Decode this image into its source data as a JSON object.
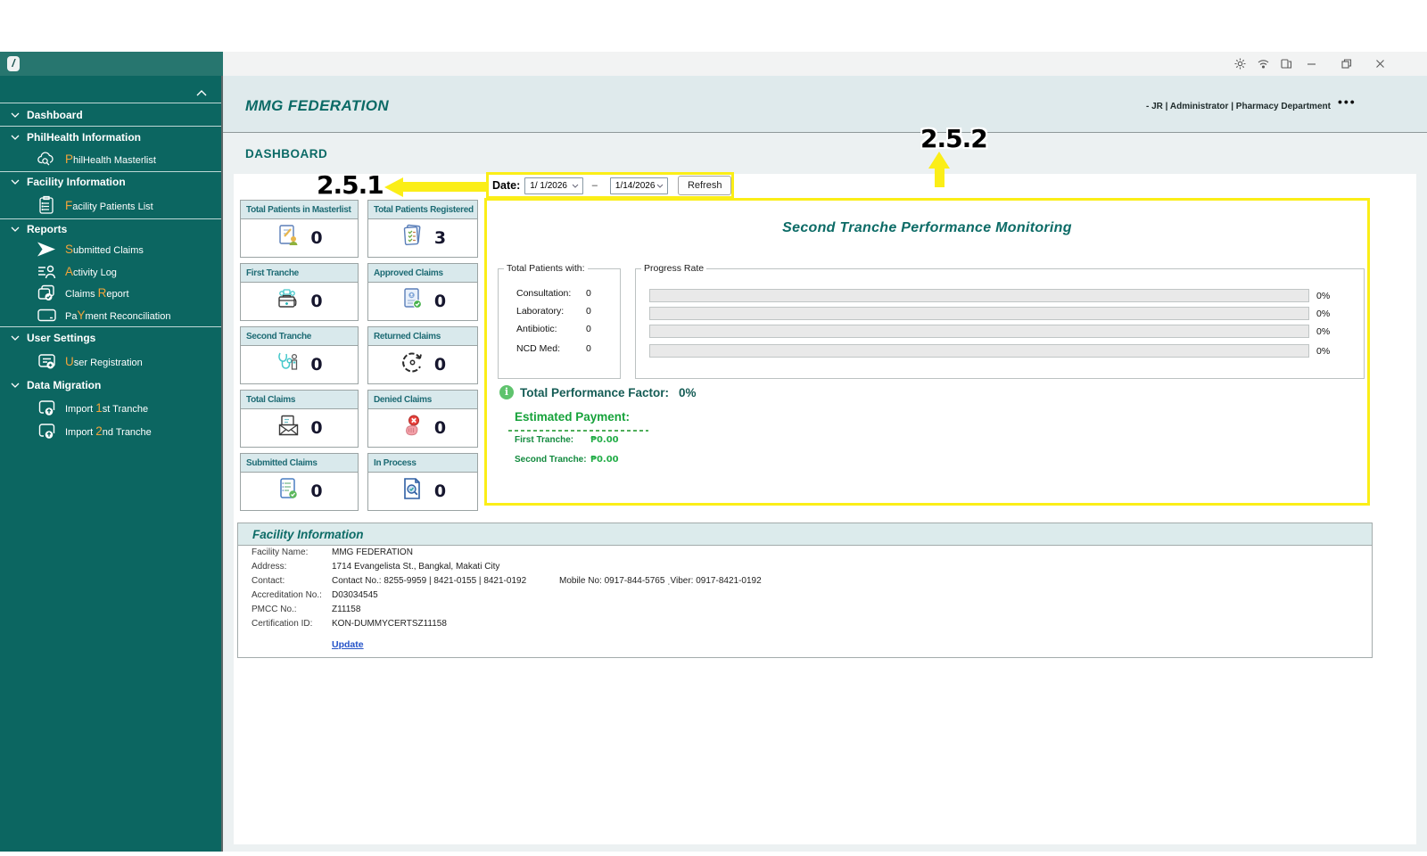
{
  "titlebar": {
    "icons": [
      "settings",
      "wifi",
      "window-switch",
      "minimize",
      "maximize",
      "close"
    ]
  },
  "sidebar": {
    "sections": [
      {
        "label": "Dashboard"
      },
      {
        "label": "PhilHealth Information"
      },
      {
        "label": "Facility Information"
      },
      {
        "label": "Reports"
      },
      {
        "label": "User Settings"
      },
      {
        "label": "Data Migration"
      }
    ],
    "items": {
      "masterlist": {
        "pre": "",
        "hot": "P",
        "post": "hilHealth Masterlist"
      },
      "patients": {
        "pre": "",
        "hot": "F",
        "post": "acility Patients List"
      },
      "submitted": {
        "pre": "",
        "hot": "S",
        "post": "ubmitted Claims"
      },
      "activity": {
        "pre": "",
        "hot": "A",
        "post": "ctivity Log"
      },
      "claimsreport": {
        "pre": "Claims ",
        "hot": "R",
        "post": "eport"
      },
      "payment": {
        "pre": "Pa",
        "hot": "Y",
        "post": "ment Reconciliation"
      },
      "userreg": {
        "pre": "",
        "hot": "U",
        "post": "ser Registration"
      },
      "import1": {
        "pre": "Import ",
        "hot": "1",
        "post": "st Tranche"
      },
      "import2": {
        "pre": "Import ",
        "hot": "2",
        "post": "nd Tranche"
      }
    }
  },
  "header": {
    "brand": "MMG FEDERATION",
    "user": "-  JR | Administrator | Pharmacy Department",
    "menu": "•••",
    "page_title": "DASHBOARD"
  },
  "filters": {
    "date_label": "Date:",
    "from": "1/ 1/2026",
    "dash": "–",
    "to": "1/14/2026",
    "refresh": "Refresh"
  },
  "annotations": {
    "a1": "2.5.1",
    "a2": "2.5.2"
  },
  "stats": {
    "cards": [
      {
        "title": "Total Patients in Masterlist",
        "value": "0",
        "icon": "doc-person"
      },
      {
        "title": "Total Patients Registered",
        "value": "3",
        "icon": "docs-check"
      },
      {
        "title": "First Tranche",
        "value": "0",
        "icon": "med-kit"
      },
      {
        "title": "Approved Claims",
        "value": "0",
        "icon": "doc-approved"
      },
      {
        "title": "Second Tranche",
        "value": "0",
        "icon": "stethoscope"
      },
      {
        "title": "Returned Claims",
        "value": "0",
        "icon": "return-arrow"
      },
      {
        "title": "Total Claims",
        "value": "0",
        "icon": "mail-doc"
      },
      {
        "title": "Denied Claims",
        "value": "0",
        "icon": "denied-hand"
      },
      {
        "title": "Submitted Claims",
        "value": "0",
        "icon": "doc-sent"
      },
      {
        "title": "In Process",
        "value": "0",
        "icon": "doc-search"
      }
    ]
  },
  "monitor": {
    "title": "Second Tranche Performance Monitoring",
    "patients_legend": "Total Patients with:",
    "patients": [
      {
        "label": "Consultation:",
        "value": "0"
      },
      {
        "label": "Laboratory:",
        "value": "0"
      },
      {
        "label": "Antibiotic:",
        "value": "0"
      },
      {
        "label": "NCD Med:",
        "value": "0"
      }
    ],
    "progress_legend": "Progress Rate",
    "progress": [
      {
        "value": 0,
        "label": "0%"
      },
      {
        "value": 0,
        "label": "0%"
      },
      {
        "value": 0,
        "label": "0%"
      },
      {
        "value": 0,
        "label": "0%"
      }
    ],
    "tpf_label": "Total Performance Factor:",
    "tpf_value": "0%",
    "estimated_label": "Estimated Payment:",
    "payments": [
      {
        "label": "First Tranche:",
        "value": "₱0.00"
      },
      {
        "label": "Second Tranche:",
        "value": "₱0.00"
      }
    ]
  },
  "facility": {
    "title": "Facility Information",
    "rows": [
      {
        "label": "Facility Name:",
        "value": "MMG FEDERATION"
      },
      {
        "label": "Address:",
        "value": "1714 Evangelista St., Bangkal, Makati City"
      },
      {
        "label": "Contact:",
        "value": "Contact No.: 8255-9959 | 8421-0155 | 8421-0192",
        "value2": "Mobile No: 0917-844-5765 ˌViber: 0917-8421-0192"
      },
      {
        "label": "Accreditation No.:",
        "value": "D03034545"
      },
      {
        "label": "PMCC No.:",
        "value": "Z11158"
      },
      {
        "label": "Certification ID:",
        "value": "KON-DUMMYCERTSZ11158"
      }
    ],
    "update": "Update"
  }
}
